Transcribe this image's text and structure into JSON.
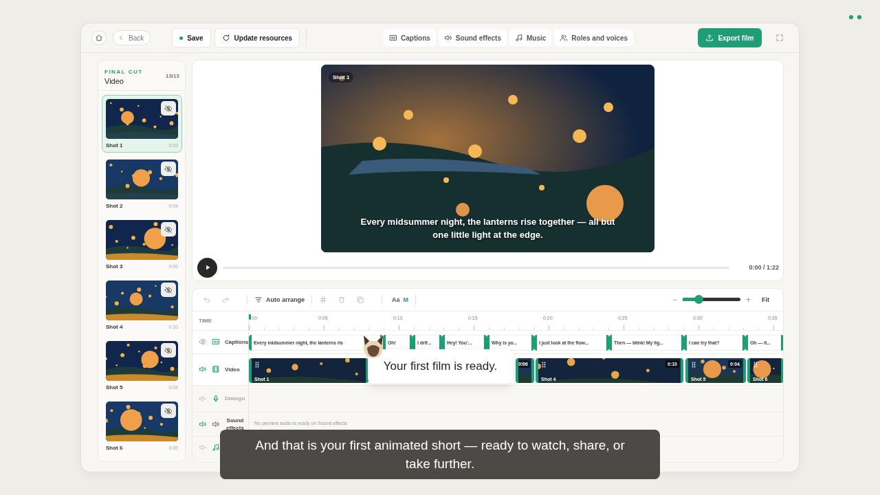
{
  "topbar": {
    "back": "Back",
    "save": "Save",
    "update": "Update resources",
    "tabs": [
      {
        "kind": "captions",
        "label": "Captions",
        "selected": false
      },
      {
        "kind": "sound",
        "label": "Sound effects",
        "selected": false
      },
      {
        "kind": "music",
        "label": "Music",
        "selected": false
      },
      {
        "kind": "roles",
        "label": "Roles and voices",
        "selected": false
      }
    ],
    "export": "Export film"
  },
  "panel": {
    "eyebrow": "FINAL CUT",
    "title": "Video",
    "count": "13/13",
    "shots": [
      {
        "label": "Shot 1",
        "duration": "0:09",
        "selected": true
      },
      {
        "label": "Shot 2",
        "duration": "0:04",
        "selected": false
      },
      {
        "label": "Shot 3",
        "duration": "0:06",
        "selected": false
      },
      {
        "label": "Shot 4",
        "duration": "0:10",
        "selected": false
      },
      {
        "label": "Shot 5",
        "duration": "0:04",
        "selected": false
      },
      {
        "label": "Shot 6",
        "duration": "0:05",
        "selected": false
      }
    ]
  },
  "preview": {
    "badge": "Shot 1",
    "caption": "Every midsummer night, the lanterns rise together — all but one little light at the edge.",
    "progress": {
      "level": 0
    },
    "time": "0:00 / 1:22"
  },
  "timeline": {
    "toolbar": {
      "history": [
        {
          "kind": "undo",
          "disabled": true
        },
        {
          "kind": "redo",
          "disabled": true
        }
      ],
      "auto_arrange": "Auto arrange",
      "edit": [
        {
          "kind": "split",
          "disabled": true
        },
        {
          "kind": "delete",
          "disabled": true
        },
        {
          "kind": "duplicate",
          "disabled": true
        }
      ],
      "text_size": {
        "label": "Aa",
        "value": "M"
      },
      "zoom": {
        "minus": "−",
        "plus": "+",
        "level": 0.27
      },
      "fit": "Fit"
    },
    "ruler": {
      "heading": "TIME",
      "ticks": [
        "00",
        "0:05",
        "0:10",
        "0:15",
        "0:20",
        "0:25",
        "0:30",
        "0:35"
      ]
    },
    "tracks": [
      {
        "kind": "captions",
        "label": "Captions",
        "visible": true,
        "clips": [
          "Every midsummer night, the lanterns ris",
          "Oh!",
          "I drif...",
          "Hey! You'...",
          "Why is yo...",
          "I just look at the flow...",
          "Then — blink! My lig...",
          "I can try that?",
          "Oh — it..."
        ]
      },
      {
        "kind": "video",
        "label": "Video",
        "muted": false,
        "clips": [
          {
            "label": "Shot 1"
          },
          {
            "duration": "0:06"
          },
          {
            "label": "Shot 4",
            "duration": "0:10"
          },
          {
            "label": "Shot 5",
            "duration": "0:04"
          },
          {
            "label": "Shot 6"
          }
        ]
      },
      {
        "kind": "dialogue",
        "label": "Dialogu",
        "muted": true
      },
      {
        "kind": "sound",
        "label": "Sound effects",
        "muted": false,
        "note": "No preview audio is ready on Sound effects"
      },
      {
        "kind": "music",
        "muted": true
      }
    ]
  },
  "tooltip": "Your first film is ready.",
  "narration": "And that is your first animated short — ready to watch, share, or take further."
}
